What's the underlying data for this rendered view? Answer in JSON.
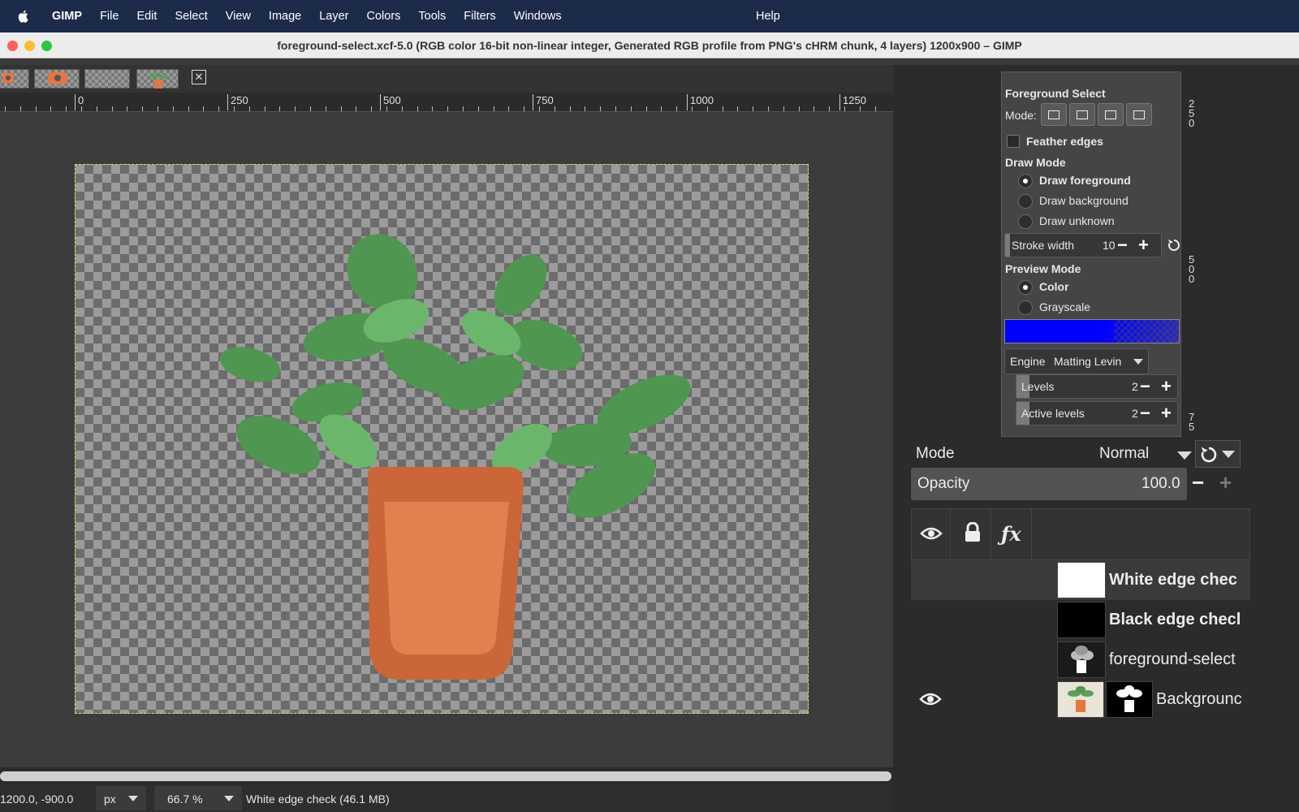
{
  "menubar": {
    "app": "GIMP",
    "items": [
      "File",
      "Edit",
      "Select",
      "View",
      "Image",
      "Layer",
      "Colors",
      "Tools",
      "Filters",
      "Windows"
    ],
    "help": "Help"
  },
  "window": {
    "title": "foreground-select.xcf-5.0 (RGB color 16-bit non-linear integer, Generated RGB profile from PNG's cHRM chunk, 4 layers) 1200x900 – GIMP",
    "traffic_lights": [
      "#ff5f57",
      "#febc2e",
      "#28c840"
    ]
  },
  "ruler": {
    "labels": [
      "0",
      "250",
      "500",
      "750",
      "1000",
      "1250"
    ]
  },
  "status": {
    "coords": "1200.0, -900.0",
    "unit": "px",
    "zoom": "66.7 %",
    "message": "White edge check (46.1 MB)"
  },
  "tool_options": {
    "title": "Foreground Select",
    "mode_label": "Mode:",
    "feather_edges": "Feather edges",
    "draw_mode_title": "Draw Mode",
    "draw_mode_options": [
      "Draw foreground",
      "Draw background",
      "Draw unknown"
    ],
    "draw_mode_selected": "Draw foreground",
    "stroke_width_label": "Stroke width",
    "stroke_width_value": "10",
    "preview_mode_title": "Preview Mode",
    "preview_options": [
      "Color",
      "Grayscale"
    ],
    "preview_selected": "Color",
    "preview_color": "#0000ff",
    "engine_label": "Engine",
    "engine_value": "Matting Levin",
    "levels_label": "Levels",
    "levels_value": "2",
    "active_levels_label": "Active levels",
    "active_levels_value": "2"
  },
  "vruler": {
    "labels": [
      "2\n5\n0",
      "5\n0\n0",
      "7\n5"
    ]
  },
  "layers": {
    "mode_label": "Mode",
    "mode_value": "Normal",
    "opacity_label": "Opacity",
    "opacity_value": "100.0",
    "items": [
      {
        "name": "White edge chec",
        "bold": true,
        "visible": false
      },
      {
        "name": "Black edge checl",
        "bold": true,
        "visible": false
      },
      {
        "name": "foreground-select",
        "bold": false,
        "visible": false
      },
      {
        "name": "Backgrounc",
        "bold": false,
        "visible": true
      }
    ]
  },
  "icons": {
    "apple": "apple-icon",
    "close_tab": "close-icon",
    "eye": "eye-icon",
    "lock": "lock-icon",
    "fx": "fx-icon",
    "reset": "reset-icon",
    "dropdown": "chevron-down-icon"
  }
}
